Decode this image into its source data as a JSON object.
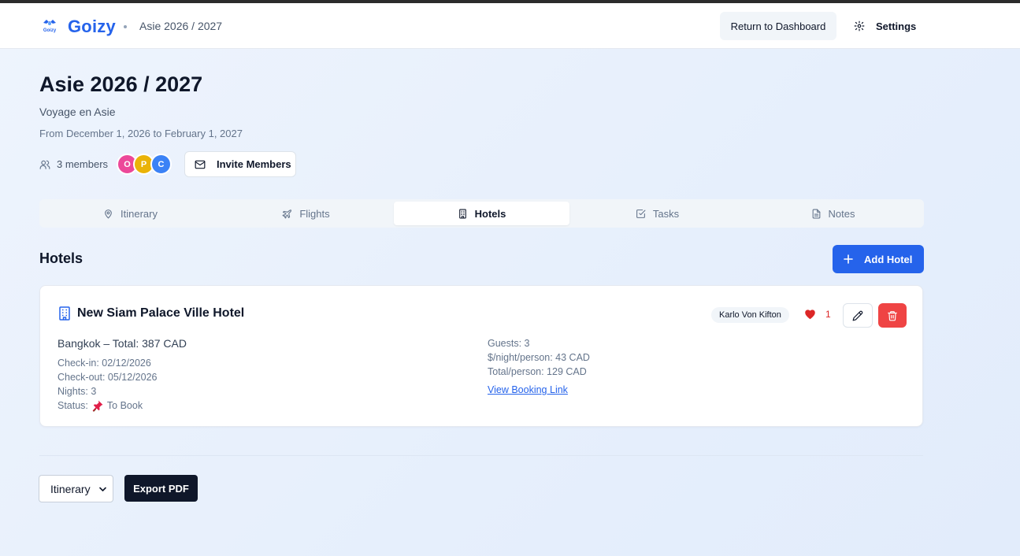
{
  "app": {
    "brand": "Goizy",
    "logo_text": "Goizy"
  },
  "header": {
    "breadcrumb": "Asie 2026 / 2027",
    "dashboard_label": "Return to Dashboard",
    "settings_label": "Settings"
  },
  "trip": {
    "title": "Asie 2026 / 2027",
    "subtitle": "Voyage en Asie",
    "dates": "From December 1, 2026 to February 1, 2027",
    "members_label": "3 members",
    "avatars": [
      {
        "initial": "O",
        "color": "#ec4899"
      },
      {
        "initial": "P",
        "color": "#eab308"
      },
      {
        "initial": "C",
        "color": "#3b82f6"
      }
    ],
    "invite_label": "Invite Members"
  },
  "tabs": [
    {
      "label": "Itinerary",
      "icon": "map-pin-icon"
    },
    {
      "label": "Flights",
      "icon": "plane-icon"
    },
    {
      "label": "Hotels",
      "icon": "building-icon",
      "active": true
    },
    {
      "label": "Tasks",
      "icon": "checkbox-icon"
    },
    {
      "label": "Notes",
      "icon": "document-icon"
    }
  ],
  "hotels_section": {
    "title": "Hotels",
    "add_label": "Add Hotel"
  },
  "hotel": {
    "name": "New Siam Palace Ville Hotel",
    "owner": "Karlo Von Kifton",
    "likes": "1",
    "location_total": "Bangkok – Total: 387 CAD",
    "check_in": "Check-in: 02/12/2026",
    "check_out": "Check-out: 05/12/2026",
    "nights": "Nights: 3",
    "status_prefix": "Status:",
    "status_value": "To Book",
    "guests": "Guests: 3",
    "per_night_person": "$/night/person: 43 CAD",
    "total_person": "Total/person: 129 CAD",
    "booking_link": "View Booking Link"
  },
  "footer": {
    "select_value": "Itinerary",
    "export_label": "Export PDF"
  },
  "colors": {
    "accent": "#2563eb",
    "danger": "#ef4444",
    "dark": "#0f172a"
  }
}
